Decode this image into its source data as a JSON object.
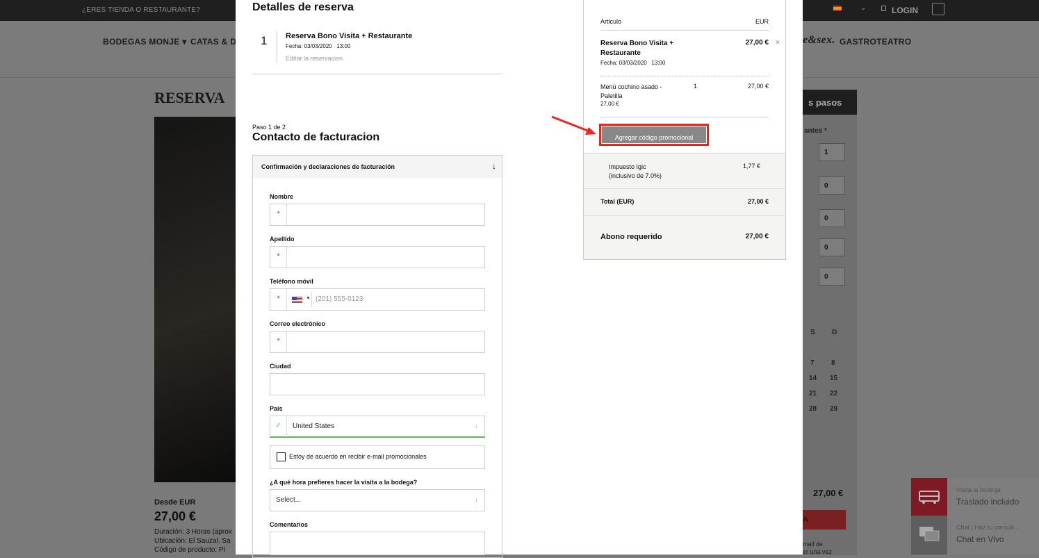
{
  "topbar": {
    "left_text": "¿ERES TIENDA O RESTAURANTE?",
    "login": "LOGIN"
  },
  "navbar": {
    "item1": "BODEGAS MONJE ▾",
    "item2": "CATAS & DE",
    "item3": "e&sex.",
    "item4": "GASTROTEATRO"
  },
  "background": {
    "title": "RESERVA",
    "desde": "Desde EUR",
    "price": "27,00 €",
    "duracion": "Duración: 3 Horas (aprox",
    "ubicacion": "Ubicación: El Sauzal, Sa",
    "codigo": "Código de producto: PI",
    "right_head": "s pasos",
    "right_label": "antes *",
    "selects": [
      "1",
      "0",
      "0",
      "0",
      "0"
    ],
    "cal_days": [
      "S",
      "D",
      "7",
      "8",
      "14",
      "15",
      "21",
      "22",
      "28",
      "29"
    ],
    "right_price": "27,00 €",
    "right_btn": "A",
    "right_note1": "mail de",
    "right_note2": "er una vez"
  },
  "widgets": [
    {
      "t1": "Visita la bodega",
      "t2": "Traslado incluido"
    },
    {
      "t1": "Chat | Haz tu consult...",
      "t2": "Chat en Vivo"
    }
  ],
  "modal": {
    "detalles_title": "Detalles de reserva",
    "res_num": "1",
    "res_name": "Reserva Bono Visita + Restaurante",
    "res_date": "Fecha: 03/03/2020   13:00",
    "res_edit": "Editar la reservacion",
    "paso": "Paso 1 de 2",
    "contacto": "Contacto de facturacion",
    "section_head": "Confirmación y declaraciones de facturación",
    "fields": {
      "nombre": "Nombre",
      "apellido": "Apellido",
      "telefono": "Teléfono móvil",
      "telefono_ph": "(201) 555-0123",
      "correo": "Correo electrónico",
      "ciudad": "Ciudad",
      "pais": "País",
      "pais_val": "United States",
      "checkbox": "Estoy de acuerdo en recibir e-mail promocionales",
      "hora": "¿A qué hora prefieres hacer la visita a la bodega?",
      "hora_val": "Select...",
      "comentarios": "Comentarios"
    },
    "req_mark": "*"
  },
  "summary": {
    "h_articulo": "Articulo",
    "h_eur": "EUR",
    "item_name": "Reserva Bono Visita + Restaurante",
    "item_price": "27,00 €",
    "item_date": "Fecha: 03/03/2020   13:00",
    "sub_name": "Menú cochino asado - Paletilla",
    "sub_qty": "1",
    "sub_price": "27,00 €",
    "sub_unit": "27,00 €",
    "promo": "Agregar código promocional",
    "tax_label": "Impuesto Igic\n(inclusivo de 7.0%)",
    "tax_line1": "Impuesto Igic",
    "tax_line2": "(inclusivo de 7.0%)",
    "tax_value": "1,77 €",
    "total_label": "Total (EUR)",
    "total_value": "27,00 €",
    "abono_label": "Abono requerido",
    "abono_value": "27,00 €"
  },
  "colors": {
    "accent_red": "#e5281d",
    "valid_green": "#5cb85c"
  }
}
